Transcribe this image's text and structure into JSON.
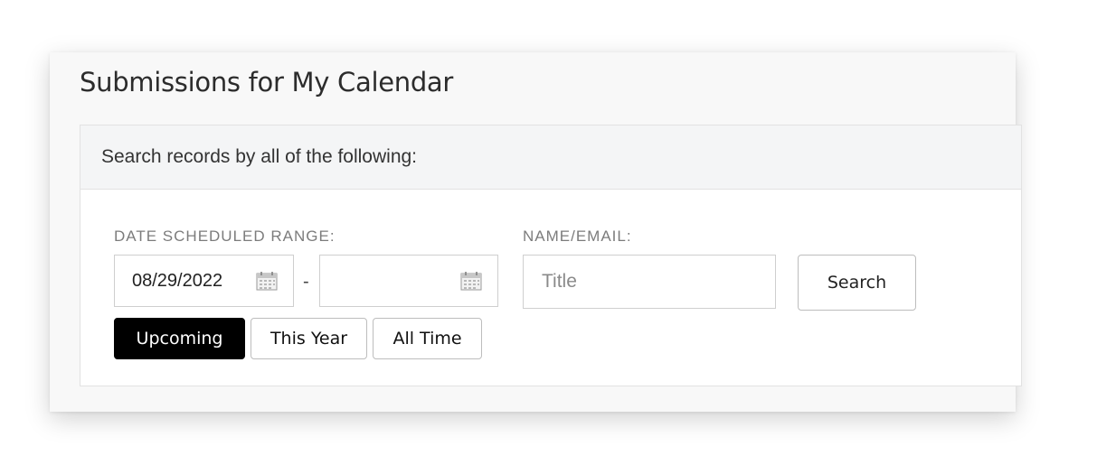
{
  "page": {
    "title": "Submissions for My Calendar"
  },
  "filters": {
    "header": "Search records by all of the following:",
    "date_range": {
      "label": "DATE SCHEDULED RANGE:",
      "start_value": "08/29/2022",
      "end_value": "",
      "separator": "-",
      "icon": "calendar-icon"
    },
    "name_email": {
      "label": "NAME/EMAIL:",
      "value": "",
      "placeholder": "Title"
    },
    "search_button": "Search",
    "quick_ranges": [
      {
        "label": "Upcoming",
        "active": true
      },
      {
        "label": "This Year",
        "active": false
      },
      {
        "label": "All Time",
        "active": false
      }
    ]
  },
  "colors": {
    "active_chip_bg": "#000000",
    "active_chip_text": "#ffffff",
    "header_bg": "#f4f5f6"
  }
}
